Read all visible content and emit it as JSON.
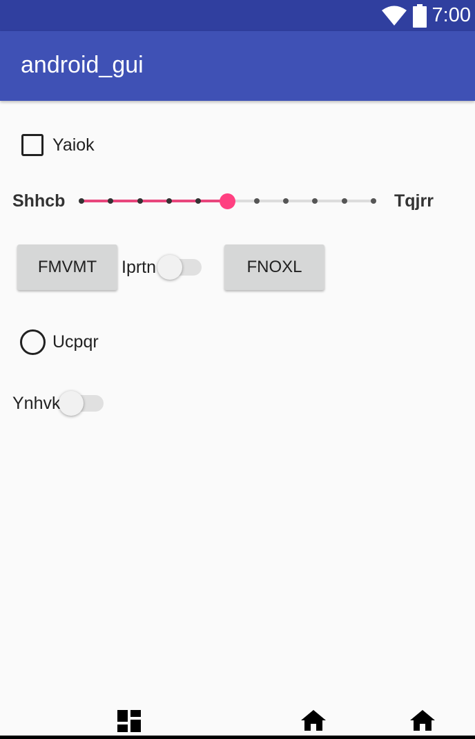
{
  "status_bar": {
    "time": "7:00",
    "icons": [
      "wifi-icon",
      "battery-icon"
    ],
    "background": "#303f9f"
  },
  "app_bar": {
    "title": "android_gui",
    "background": "#3f51b5"
  },
  "checkbox": {
    "label": "Yaiok",
    "checked": false
  },
  "slider": {
    "min_label": "Shhcb",
    "max_label": "Tqjrr",
    "steps": 10,
    "value": 5,
    "accent": "#ff4081"
  },
  "buttons": [
    {
      "label": "FMVMT"
    },
    {
      "label": "FNOXL"
    }
  ],
  "switches": [
    {
      "label": "Iprtn",
      "checked": false
    },
    {
      "label": "Ynhvk",
      "checked": false
    }
  ],
  "radio": {
    "label": "Ucpqr",
    "selected": false
  },
  "nav_bar": {
    "icons": [
      "dashboard-icon",
      "home-icon",
      "home-icon"
    ]
  }
}
